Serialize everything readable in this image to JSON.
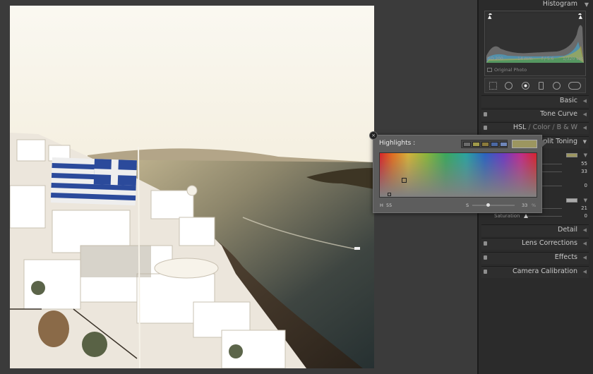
{
  "panel": {
    "histogram": {
      "title": "Histogram",
      "meta": {
        "iso": "ISO 200",
        "focal": "14 mm",
        "aperture": "f / 5.6",
        "shutter": "1/320 sec"
      },
      "original_photo": "Original Photo"
    },
    "sections": {
      "basic": "Basic",
      "tone_curve": "Tone Curve",
      "hsl": "HSL",
      "color": "Color",
      "bw": "B & W",
      "sep1": "/",
      "sep2": "/",
      "split_toning": "plit Toning",
      "detail": "Detail",
      "lens": "Lens Corrections",
      "effects": "Effects",
      "camera": "Camera Calibration"
    },
    "split_toning": {
      "highlights_hue": "55",
      "highlights_sat": "33",
      "balance": "0",
      "shadows_hue": "21",
      "shadows_sat": "0",
      "saturation_label": "Saturation"
    }
  },
  "picker": {
    "title": "Highlights :",
    "h_label": "H",
    "h_value": "55",
    "s_label": "S",
    "s_value": "33",
    "percent": "%",
    "close": "×",
    "current_color": "#9c9660"
  }
}
